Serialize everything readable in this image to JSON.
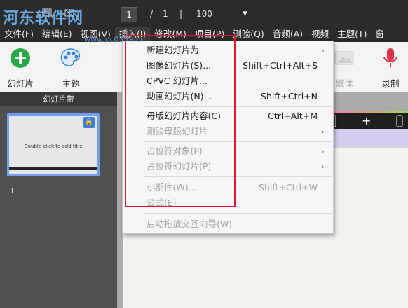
{
  "watermark": {
    "logo": "河东软件网",
    "url": "www.pc0359.cn"
  },
  "titlebar": {
    "page_current": "1",
    "page_sep": "/",
    "page_total": "1",
    "divider": "|",
    "zoom": "100",
    "zoom_arrow": "▼"
  },
  "menubar": {
    "items": [
      "文件(F)",
      "编辑(E)",
      "视图(V)",
      "插入(I)",
      "修改(M)",
      "项目(P)",
      "测验(Q)",
      "音频(A)",
      "视频",
      "主题(T)",
      "窗"
    ]
  },
  "ribbon": {
    "slides_label": "幻灯片",
    "themes_label": "主题",
    "media_label": "媒体",
    "record_label": "录制",
    "accent_green": "#27a844",
    "accent_red": "#e0314b"
  },
  "filmstrip": {
    "title": "幻灯片带",
    "thumb_text": "Double click to add title",
    "slide_number": "1"
  },
  "preview_bar": {
    "plus": "+"
  },
  "dropdown": {
    "items": [
      {
        "label": "新建幻灯片为",
        "shortcut": "",
        "submenu": true,
        "disabled": false
      },
      {
        "label": "图像幻灯片(S)...",
        "shortcut": "Shift+Ctrl+Alt+S",
        "submenu": false,
        "disabled": false
      },
      {
        "label": "CPVC 幻灯片...",
        "shortcut": "",
        "submenu": false,
        "disabled": false
      },
      {
        "label": "动画幻灯片(N)...",
        "shortcut": "Shift+Ctrl+N",
        "submenu": false,
        "disabled": false
      },
      {
        "label": "母版幻灯片内容(C)",
        "shortcut": "Ctrl+Alt+M",
        "submenu": false,
        "disabled": false
      },
      {
        "label": "测验母版幻灯片",
        "shortcut": "",
        "submenu": true,
        "disabled": true
      },
      {
        "label": "占位符对象(P)",
        "shortcut": "",
        "submenu": true,
        "disabled": true
      },
      {
        "label": "占位符幻灯片(P)",
        "shortcut": "",
        "submenu": true,
        "disabled": true
      },
      {
        "label": "小部件(W)...",
        "shortcut": "Shift+Ctrl+W",
        "submenu": false,
        "disabled": true
      },
      {
        "label": "公式(E)",
        "shortcut": "",
        "submenu": false,
        "disabled": true
      },
      {
        "label": "启动拖放交互向导(W)",
        "shortcut": "",
        "submenu": false,
        "disabled": true
      }
    ]
  },
  "annotation_color": "#e0142a"
}
